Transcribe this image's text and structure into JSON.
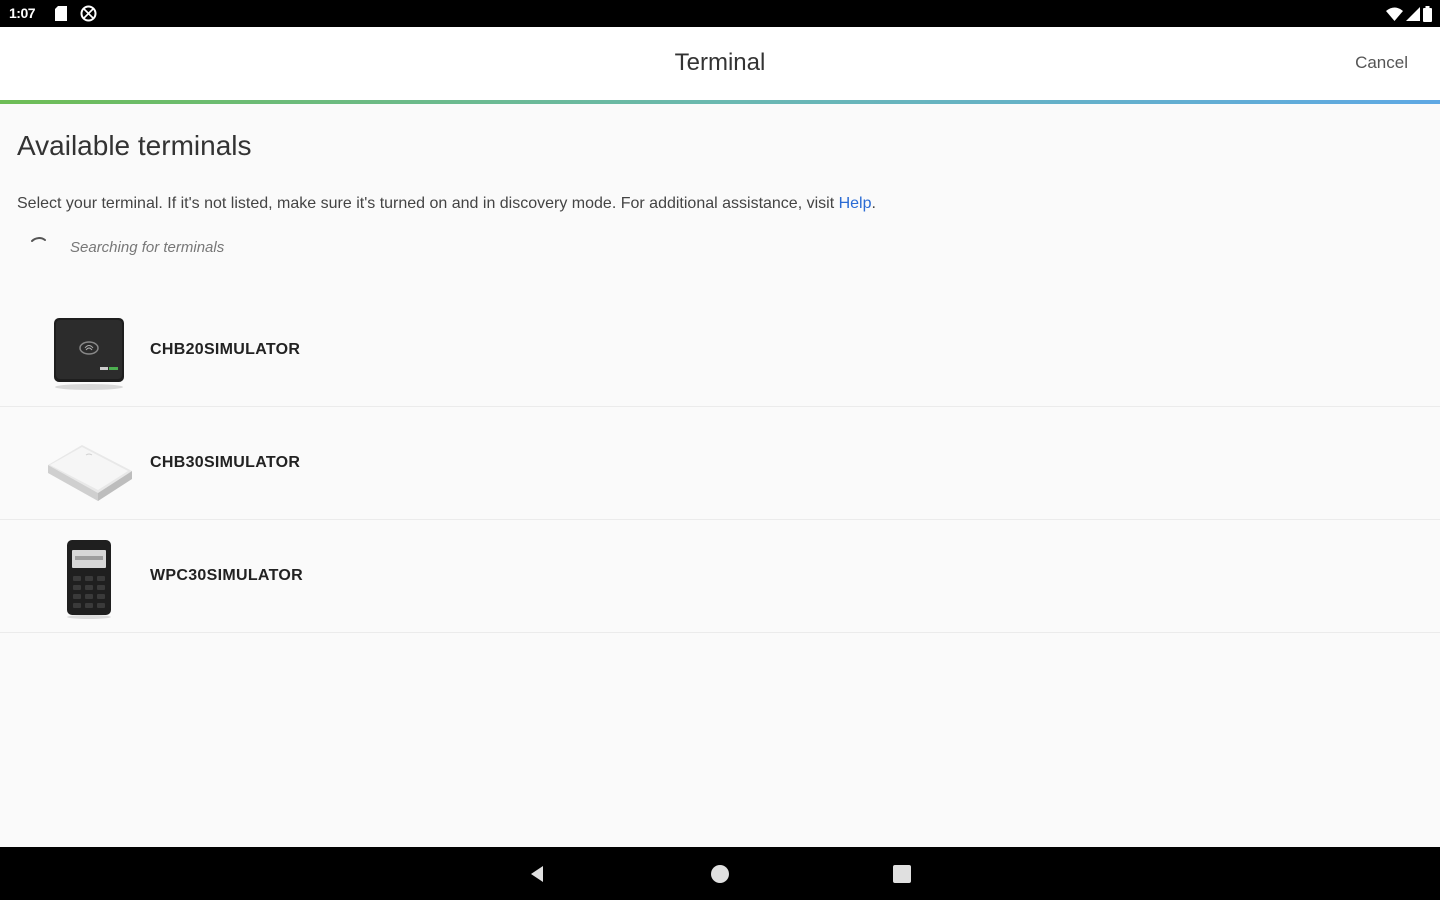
{
  "status_bar": {
    "time": "1:07"
  },
  "app_bar": {
    "title": "Terminal",
    "cancel_label": "Cancel"
  },
  "content": {
    "heading": "Available terminals",
    "description": "Select your terminal. If it's not listed, make sure it's turned on and in discovery mode. For additional assistance, visit ",
    "help_link": "Help",
    "description_end": ".",
    "searching_text": "Searching for terminals"
  },
  "terminals": [
    {
      "name": "CHB20SIMULATOR",
      "icon": "card-reader-black-icon"
    },
    {
      "name": "CHB30SIMULATOR",
      "icon": "card-reader-white-icon"
    },
    {
      "name": "WPC30SIMULATOR",
      "icon": "pin-pad-terminal-icon"
    }
  ],
  "colors": {
    "accent_gradient": [
      "#6dbd55",
      "#6ab8b0",
      "#5ea8e4"
    ],
    "link": "#2a6bd4"
  }
}
